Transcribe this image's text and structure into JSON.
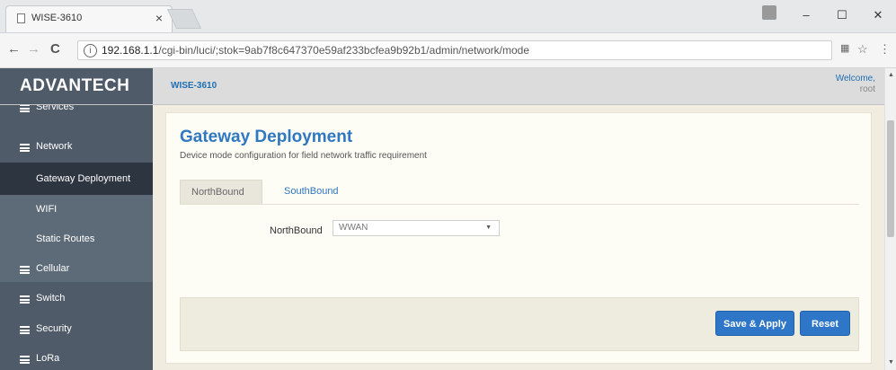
{
  "browser": {
    "tab_title": "WISE-3610",
    "tab_close": "×",
    "url_host": "192.168.1.1",
    "url_path": "/cgi-bin/luci/;stok=9ab7f8c647370e59af233bcfea9b92b1/admin/network/mode",
    "win_minimize": "–",
    "win_maximize": "☐",
    "win_close": "✕",
    "back": "←",
    "forward": "→",
    "reload": "C",
    "star": "☆",
    "menu": "⋮"
  },
  "header": {
    "logo": "ADVANTECH",
    "device": "WISE-3610",
    "welcome": "Welcome,",
    "user": "root"
  },
  "sidebar": {
    "items": [
      {
        "label": "Services"
      },
      {
        "label": "Network"
      },
      {
        "label": "Gateway Deployment"
      },
      {
        "label": "WIFI"
      },
      {
        "label": "Static Routes"
      },
      {
        "label": "Cellular"
      },
      {
        "label": "Switch"
      },
      {
        "label": "Security"
      },
      {
        "label": "LoRa"
      }
    ]
  },
  "main": {
    "title": "Gateway Deployment",
    "description": "Device mode configuration for field network traffic requirement",
    "tabs": [
      {
        "label": "NorthBound",
        "active": true
      },
      {
        "label": "SouthBound",
        "active": false
      }
    ],
    "field_label": "NorthBound",
    "field_value": "WWAN",
    "save_label": "Save & Apply",
    "reset_label": "Reset"
  },
  "colors": {
    "accent": "#2f78c0",
    "sidebar": "#4f5b68",
    "sidebar_active": "#2c3540",
    "button": "#2d76c8"
  },
  "icons": [
    "page-icon",
    "info-icon",
    "translate-icon",
    "star-icon",
    "menu-icon",
    "hamburger-icon",
    "dropdown-arrow-icon"
  ]
}
